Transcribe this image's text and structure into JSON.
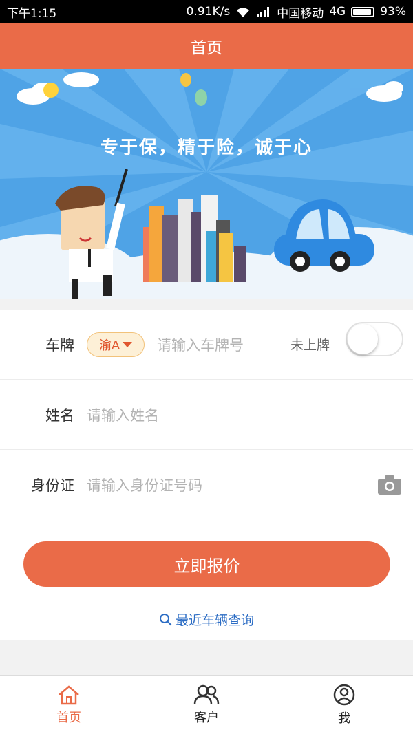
{
  "status_bar": {
    "time": "下午1:15",
    "speed": "0.91K/s",
    "carrier": "中国移动",
    "network": "4G",
    "battery": "93%",
    "icons": [
      "wifi-icon",
      "signal-icon",
      "battery-icon"
    ]
  },
  "header": {
    "title": "首页"
  },
  "banner": {
    "slogan": "专于保，精于险，诚于心"
  },
  "form": {
    "plate": {
      "label": "车牌",
      "prefix": "渝A",
      "placeholder": "请输入车牌号",
      "unregistered_label": "未上牌",
      "unregistered_on": false
    },
    "name": {
      "label": "姓名",
      "placeholder": "请输入姓名"
    },
    "id_card": {
      "label": "身份证",
      "placeholder": "请输入身份证号码",
      "icon": "camera-icon"
    }
  },
  "actions": {
    "quote_label": "立即报价",
    "recent_query_label": "最近车辆查询"
  },
  "tabs": [
    {
      "label": "首页",
      "icon": "home-icon",
      "active": true
    },
    {
      "label": "客户",
      "icon": "customers-icon",
      "active": false
    },
    {
      "label": "我",
      "icon": "profile-icon",
      "active": false
    }
  ],
  "colors": {
    "accent": "#ea6b48",
    "link": "#2b6cc4",
    "banner_sky": "#4fa3e6"
  }
}
